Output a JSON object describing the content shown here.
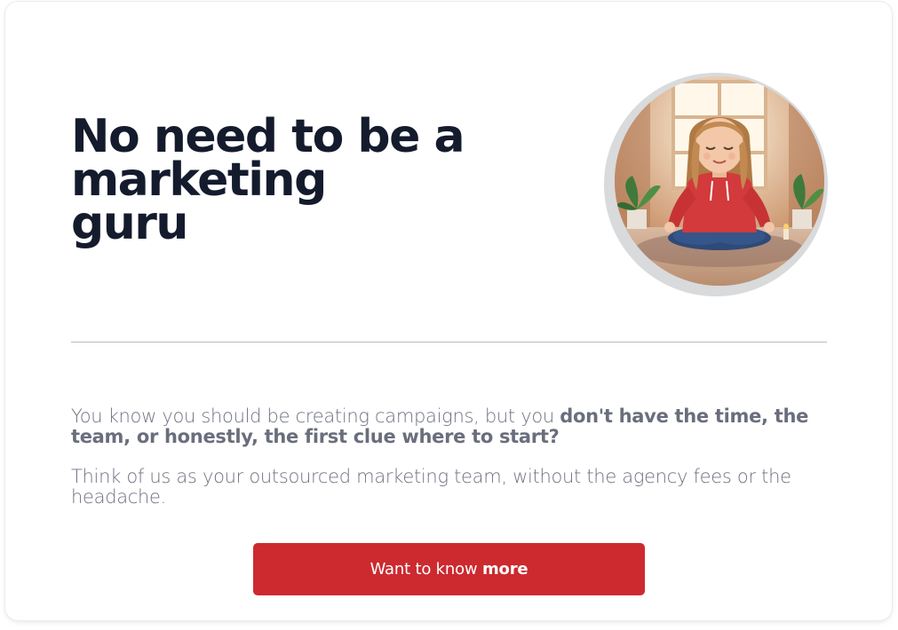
{
  "hero": {
    "title_lines": [
      "No need to be a",
      "marketing",
      "guru"
    ],
    "image_icon": "meditating-woman-illustration"
  },
  "body": {
    "para1_start": "You know you should be creating campaigns, but you ",
    "para1_bold": "don't have the time, the team, or honestly, the first clue where to start?",
    "para2": "Think of us as your outsourced marketing team, without the agency fees or the headache."
  },
  "cta": {
    "label_start": "Want to know ",
    "label_bold": "more"
  },
  "colors": {
    "accent": "#cc2a2f",
    "heading": "#141b2d",
    "body_text": "#6f7381",
    "divider": "#b9b9b9"
  }
}
